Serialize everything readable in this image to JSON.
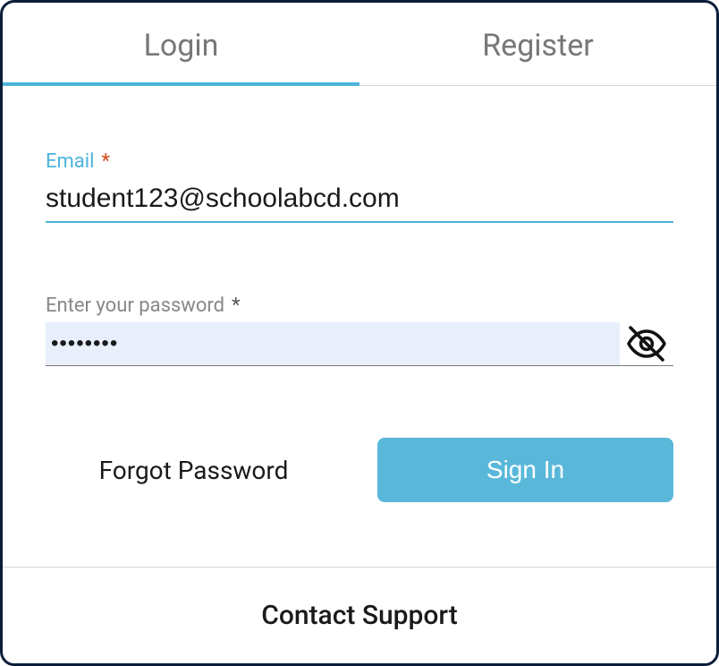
{
  "tabs": {
    "login": "Login",
    "register": "Register"
  },
  "email": {
    "label": "Email",
    "required": "*",
    "value": "student123@schoolabcd.com"
  },
  "password": {
    "label": "Enter your password",
    "required": "*",
    "value": "••••••••"
  },
  "actions": {
    "forgot": "Forgot Password",
    "signin": "Sign In"
  },
  "footer": {
    "contact": "Contact Support"
  }
}
